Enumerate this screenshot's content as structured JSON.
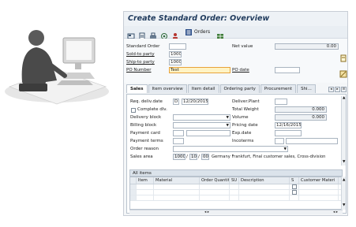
{
  "window": {
    "title": "Create Standard Order: Overview"
  },
  "toolbar": {
    "orders_label": "Orders",
    "icons": [
      "display-icon",
      "document-icon",
      "printer-icon",
      "view-icon",
      "user-icon",
      "orders-icon",
      "grid-icon"
    ]
  },
  "header": {
    "standard_order_label": "Standard Order",
    "standard_order_value": "",
    "net_value_label": "Net value",
    "net_value": "0.00",
    "sold_to_label": "Sold-to party",
    "sold_to_value": "1000",
    "ship_to_label": "Ship-to party",
    "ship_to_value": "1000",
    "po_number_label": "PO Number",
    "po_number_value": "Test",
    "po_date_label": "PO date",
    "po_date_value": ""
  },
  "tabs": [
    {
      "label": "Sales",
      "active": true
    },
    {
      "label": "Item overview",
      "active": false
    },
    {
      "label": "Item detail",
      "active": false
    },
    {
      "label": "Ordering party",
      "active": false
    },
    {
      "label": "Procurement",
      "active": false
    },
    {
      "label": "Shi...",
      "active": false
    }
  ],
  "sales": {
    "req_deliv_label": "Req. deliv.date",
    "req_deliv_unit": "D",
    "req_deliv_date": "12/20/2015",
    "deliver_plant_label": "Deliver.Plant",
    "deliver_plant_value": "",
    "complete_dlv_label": "Complete dlv.",
    "total_weight_label": "Total Weight",
    "total_weight_value": "0.000",
    "delivery_block_label": "Delivery block",
    "volume_label": "Volume",
    "volume_value": "0.000",
    "billing_block_label": "Billing block",
    "pricing_date_label": "Pricing date",
    "pricing_date_value": "12/16/2015",
    "payment_card_label": "Payment card",
    "exp_date_label": "Exp.date",
    "payment_terms_label": "Payment terms",
    "incoterms_label": "Incoterms",
    "order_reason_label": "Order reason",
    "sales_area_label": "Sales area",
    "sales_area_org": "1000",
    "sales_area_dist": "10",
    "sales_area_div": "00",
    "sales_area_text": "Germany Frankfurt, Final customer sales, Cross-division"
  },
  "items": {
    "title": "All items",
    "columns": [
      "Item",
      "Material",
      "Order Quantity",
      "SU",
      "Description",
      "S",
      "Customer Materi"
    ]
  },
  "colors": {
    "title": "#1f3a5c",
    "highlight_field": "#fff3c4",
    "window_bg": "#f4f6f8"
  }
}
